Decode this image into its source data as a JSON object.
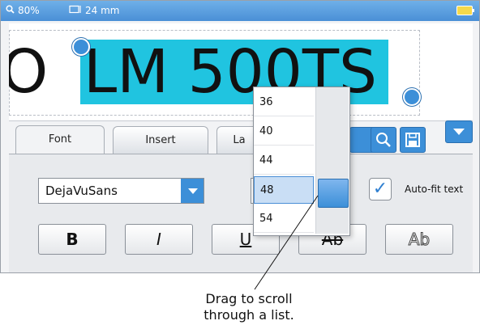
{
  "statusbar": {
    "zoom": "80%",
    "tape_width": "24 mm"
  },
  "label": {
    "text_left": "O",
    "text_selected": "LM 500TS"
  },
  "tabs": [
    {
      "label": "Font",
      "active": true
    },
    {
      "label": "Insert",
      "active": false
    },
    {
      "label": "La",
      "active": false
    }
  ],
  "toolbar": {
    "icons": [
      "zoom-icon",
      "save-icon",
      "dropdown-arrow-icon"
    ]
  },
  "font_panel": {
    "font_name": "DejaVuSans",
    "autofit_label": "Auto-fit text",
    "autofit_checked": true,
    "format_buttons": [
      {
        "label": "B",
        "name": "bold"
      },
      {
        "label": "I",
        "name": "italic"
      },
      {
        "label": "U",
        "name": "underline"
      },
      {
        "label": "Ab",
        "name": "strikethrough"
      },
      {
        "label": "Ab",
        "name": "outline"
      }
    ]
  },
  "size_dropdown": {
    "options": [
      "36",
      "40",
      "44",
      "48",
      "54"
    ],
    "selected": "48"
  },
  "caption": "Drag to scroll through a list.",
  "colors": {
    "accent": "#3c8fd8",
    "selection": "#20c4e0",
    "statusbar": "#4a8fd6"
  }
}
